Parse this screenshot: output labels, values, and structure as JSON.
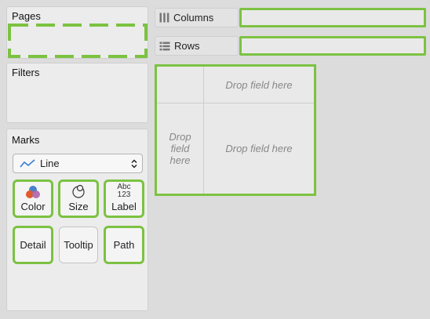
{
  "pages": {
    "title": "Pages"
  },
  "filters": {
    "title": "Filters"
  },
  "marks": {
    "title": "Marks",
    "type_icon": "line-chart-icon",
    "type_value": "Line",
    "buttons": {
      "color": {
        "label": "Color",
        "icon": "color-icon"
      },
      "size": {
        "label": "Size",
        "icon": "size-icon"
      },
      "label": {
        "label": "Label",
        "icon": "label-icon",
        "icon_text_top": "Abc",
        "icon_text_bottom": "123"
      },
      "detail": {
        "label": "Detail"
      },
      "tooltip": {
        "label": "Tooltip"
      },
      "path": {
        "label": "Path"
      }
    }
  },
  "shelves": {
    "columns": {
      "label": "Columns",
      "icon": "columns-icon"
    },
    "rows": {
      "label": "Rows",
      "icon": "rows-icon"
    }
  },
  "view": {
    "drop_top": "Drop field here",
    "drop_left_1": "Drop",
    "drop_left_2": "field",
    "drop_left_3": "here",
    "drop_main": "Drop field here"
  },
  "colors": {
    "highlight": "#7cc242",
    "panel": "#ececec",
    "background": "#dcdcdc"
  }
}
